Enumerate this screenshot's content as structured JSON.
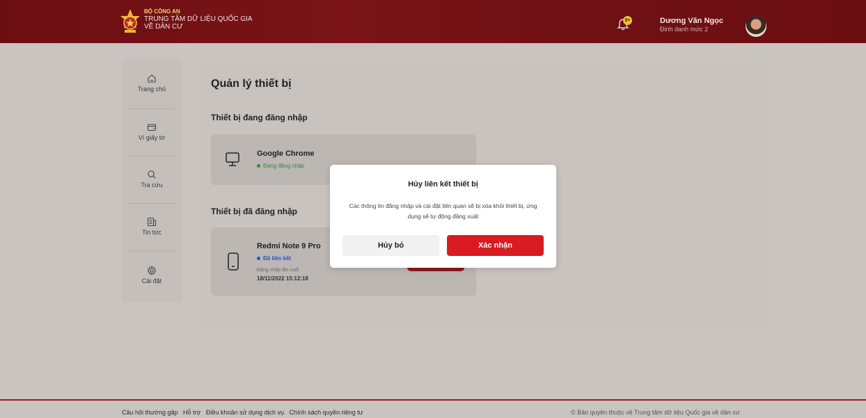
{
  "header": {
    "org_line1": "BỘ CÔNG AN",
    "org_line2": "TRUNG TÂM DỮ LIỆU QUỐC GIA",
    "org_line3": "VỀ DÂN CƯ",
    "notification_badge": "9+",
    "user_name": "Dương Văn Ngọc",
    "user_level": "Định danh mức 2",
    "brand_color": "#7a1418"
  },
  "sidebar": {
    "items": [
      {
        "label": "Trang chủ",
        "icon": "home-icon"
      },
      {
        "label": "Ví giấy tờ",
        "icon": "wallet-icon"
      },
      {
        "label": "Tra cứu",
        "icon": "search-icon"
      },
      {
        "label": "Tin tức",
        "icon": "news-icon"
      },
      {
        "label": "Cài đặt",
        "icon": "gear-icon"
      }
    ]
  },
  "main": {
    "title": "Quản lý thiết bị",
    "current_section": "Thiết bị đang đăng nhập",
    "current_device": {
      "name": "Google Chrome",
      "status": "Đang đăng nhập",
      "icon": "monitor-icon"
    },
    "past_section": "Thiết bị đã đăng nhập",
    "past_device": {
      "name": "Redmi Note 9 Pro",
      "status": "Đã liên kết",
      "last_login_label": "Đăng nhập lần cuối",
      "last_login_time": "18/11/2022 15:12:18",
      "icon": "phone-icon"
    }
  },
  "modal": {
    "title": "Hủy liên kết thiết bị",
    "body": "Các thông tin đăng nhập và cài đặt liên quan sẽ bị xóa khỏi thiết bị, ứng dụng sẽ tự động đăng xuất",
    "cancel_label": "Hủy bỏ",
    "confirm_label": "Xác nhận",
    "confirm_color": "#d91a21"
  },
  "footer": {
    "links": [
      "Câu hỏi thường gặp",
      "Hỗ trợ",
      "Điều khoản sử dụng dịch vụ",
      "Chính sách quyền riêng tư"
    ],
    "copyright": "© Bản quyền thuộc về Trung tâm dữ liệu Quốc gia về dân cư"
  }
}
